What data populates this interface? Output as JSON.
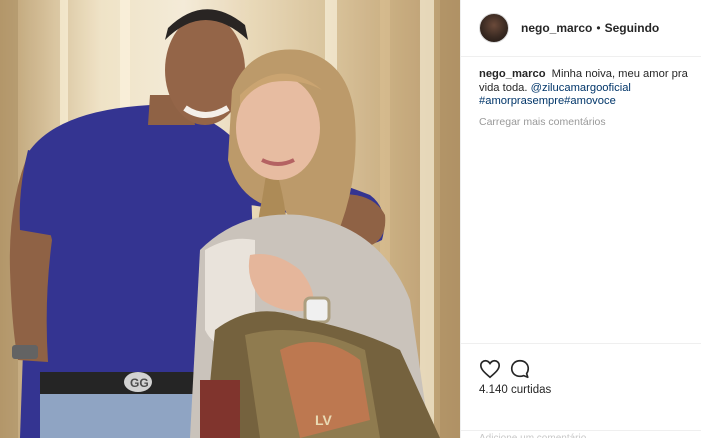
{
  "post": {
    "username": "nego_marco",
    "separator": "•",
    "follow_status": "Seguindo",
    "caption": {
      "username": "nego_marco",
      "text": "Minha noiva, meu amor pra vida toda.",
      "mention": "@zilucamargooficial",
      "hashtags": "#amorprasempre#amovoce"
    },
    "load_more_comments": "Carregar mais comentários",
    "likes": "4.140 curtidas",
    "comment_placeholder": "Adicione um comentário..."
  },
  "icons": {
    "like": "heart-icon",
    "comment": "comment-bubble-icon"
  },
  "colors": {
    "link": "#003569",
    "muted": "#999999",
    "text": "#262626",
    "border": "#efefef"
  },
  "photo": {
    "subject": "couple-embracing",
    "belt_buckle_letters": "GG",
    "bag_letters": "LV"
  }
}
